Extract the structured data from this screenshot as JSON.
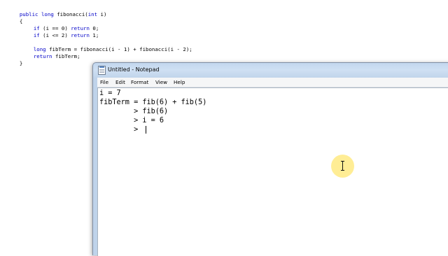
{
  "code_editor": {
    "lines": [
      [
        "public long ",
        "fibonacci(",
        "int",
        " i)"
      ],
      "{",
      [
        "    if",
        " (i == 0) ",
        "return",
        " 0;"
      ],
      [
        "    if",
        " (i <= 2) ",
        "return",
        " 1;"
      ],
      "",
      [
        "    long",
        " fibTerm = fibonacci(i - 1) + fibonacci(i - 2);"
      ],
      [
        "    return",
        " fibTerm;"
      ],
      "}"
    ],
    "line1_keyword1": "public",
    "line1_keyword2": "long",
    "line1_text": "fibonacci(",
    "line1_keyword3": "int",
    "line1_end": "i)",
    "line2": "{",
    "line3_kw1": "if",
    "line3_mid": "(i == 0)",
    "line3_kw2": "return",
    "line3_end": "0;",
    "line4_kw1": "if",
    "line4_mid": "(i <= 2)",
    "line4_kw2": "return",
    "line4_end": "1;",
    "line6_kw": "long",
    "line6_rest": "fibTerm = fibonacci(i - 1) + fibonacci(i - 2);",
    "line7_kw": "return",
    "line7_rest": "fibTerm;",
    "line8": "}"
  },
  "notepad": {
    "title": "Untitled - Notepad",
    "menu": {
      "file": "File",
      "edit": "Edit",
      "format": "Format",
      "view": "View",
      "help": "Help"
    },
    "text_lines": [
      "i = 7",
      "fibTerm = fib(6) + fib(5)",
      "        > fib(6)",
      "        > i = 6",
      "        >"
    ]
  },
  "colors": {
    "keyword": "#0000c8",
    "cursor_highlight": "#ffe782"
  }
}
